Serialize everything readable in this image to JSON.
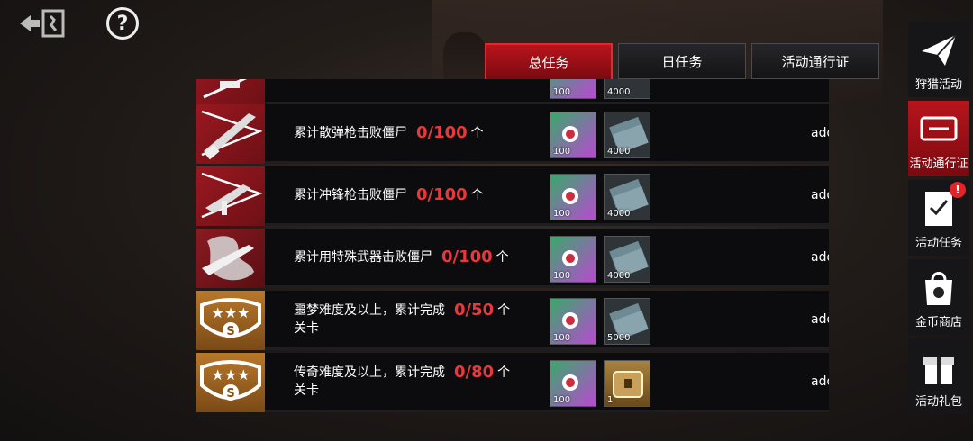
{
  "header": {
    "back_icon": "exit-door-icon",
    "help_label": "?"
  },
  "tabs": [
    {
      "label": "总任务",
      "active": true
    },
    {
      "label": "日任务",
      "active": false
    },
    {
      "label": "活动通行证",
      "active": false
    }
  ],
  "tasks": [
    {
      "text": "",
      "progress": "",
      "unit": "",
      "icon": "weapon-icon",
      "reward1_qty": "100",
      "reward2_qty": "4000",
      "action": ""
    },
    {
      "text": "累计散弹枪击败僵尸",
      "progress": "0/100",
      "unit": "个",
      "icon": "shotgun-icon",
      "reward1_qty": "100",
      "reward2_qty": "4000",
      "action": "add"
    },
    {
      "text": "累计冲锋枪击败僵尸",
      "progress": "0/100",
      "unit": "个",
      "icon": "smg-icon",
      "reward1_qty": "100",
      "reward2_qty": "4000",
      "action": "add"
    },
    {
      "text": "累计用特殊武器击败僵尸",
      "progress": "0/100",
      "unit": "个",
      "icon": "dragon-weapon-icon",
      "reward1_qty": "100",
      "reward2_qty": "4000",
      "action": "add"
    },
    {
      "text": "噩梦难度及以上，累计完成",
      "progress": "0/50",
      "unit": "个",
      "text2": "关卡",
      "icon": "three-star-badge-icon",
      "reward1_qty": "100",
      "reward2_qty": "5000",
      "action": "add"
    },
    {
      "text": "传奇难度及以上，累计完成",
      "progress": "0/80",
      "unit": "个",
      "text2": "关卡",
      "icon": "three-star-badge-icon",
      "reward1_qty": "100",
      "reward2_qty": "1",
      "action": "add"
    }
  ],
  "sidebar": [
    {
      "label": "狩猎活动",
      "icon": "paper-plane-icon",
      "active": false
    },
    {
      "label": "活动通行证",
      "icon": "ticket-icon",
      "active": true
    },
    {
      "label": "活动任务",
      "icon": "checklist-icon",
      "active": false,
      "badge": "!"
    },
    {
      "label": "金币商店",
      "icon": "shopping-bag-icon",
      "active": false
    },
    {
      "label": "活动礼包",
      "icon": "gift-icon",
      "active": false
    }
  ],
  "colors": {
    "accent": "#c8141c",
    "progress": "#e8383c"
  }
}
